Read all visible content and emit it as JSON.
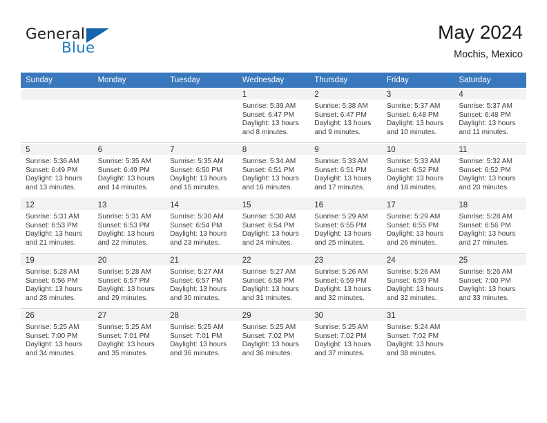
{
  "brand": {
    "name_top": "General",
    "name_bottom": "Blue",
    "flag_color": "#1564ac",
    "text_color": "#231f20",
    "accent_color": "#1f7bc1"
  },
  "header": {
    "month_title": "May 2024",
    "location": "Mochis, Mexico"
  },
  "theme": {
    "header_row_bg": "#3a78bd",
    "header_row_text": "#ffffff",
    "daynum_bg": "#f2f2f2",
    "grid_line": "#d3d3d3"
  },
  "weekdays": [
    "Sunday",
    "Monday",
    "Tuesday",
    "Wednesday",
    "Thursday",
    "Friday",
    "Saturday"
  ],
  "weeks": [
    [
      {
        "day": "",
        "sunrise": "",
        "sunset": "",
        "daylight1": "",
        "daylight2": ""
      },
      {
        "day": "",
        "sunrise": "",
        "sunset": "",
        "daylight1": "",
        "daylight2": ""
      },
      {
        "day": "",
        "sunrise": "",
        "sunset": "",
        "daylight1": "",
        "daylight2": ""
      },
      {
        "day": "1",
        "sunrise": "Sunrise: 5:39 AM",
        "sunset": "Sunset: 6:47 PM",
        "daylight1": "Daylight: 13 hours",
        "daylight2": "and 8 minutes."
      },
      {
        "day": "2",
        "sunrise": "Sunrise: 5:38 AM",
        "sunset": "Sunset: 6:47 PM",
        "daylight1": "Daylight: 13 hours",
        "daylight2": "and 9 minutes."
      },
      {
        "day": "3",
        "sunrise": "Sunrise: 5:37 AM",
        "sunset": "Sunset: 6:48 PM",
        "daylight1": "Daylight: 13 hours",
        "daylight2": "and 10 minutes."
      },
      {
        "day": "4",
        "sunrise": "Sunrise: 5:37 AM",
        "sunset": "Sunset: 6:48 PM",
        "daylight1": "Daylight: 13 hours",
        "daylight2": "and 11 minutes."
      }
    ],
    [
      {
        "day": "5",
        "sunrise": "Sunrise: 5:36 AM",
        "sunset": "Sunset: 6:49 PM",
        "daylight1": "Daylight: 13 hours",
        "daylight2": "and 13 minutes."
      },
      {
        "day": "6",
        "sunrise": "Sunrise: 5:35 AM",
        "sunset": "Sunset: 6:49 PM",
        "daylight1": "Daylight: 13 hours",
        "daylight2": "and 14 minutes."
      },
      {
        "day": "7",
        "sunrise": "Sunrise: 5:35 AM",
        "sunset": "Sunset: 6:50 PM",
        "daylight1": "Daylight: 13 hours",
        "daylight2": "and 15 minutes."
      },
      {
        "day": "8",
        "sunrise": "Sunrise: 5:34 AM",
        "sunset": "Sunset: 6:51 PM",
        "daylight1": "Daylight: 13 hours",
        "daylight2": "and 16 minutes."
      },
      {
        "day": "9",
        "sunrise": "Sunrise: 5:33 AM",
        "sunset": "Sunset: 6:51 PM",
        "daylight1": "Daylight: 13 hours",
        "daylight2": "and 17 minutes."
      },
      {
        "day": "10",
        "sunrise": "Sunrise: 5:33 AM",
        "sunset": "Sunset: 6:52 PM",
        "daylight1": "Daylight: 13 hours",
        "daylight2": "and 18 minutes."
      },
      {
        "day": "11",
        "sunrise": "Sunrise: 5:32 AM",
        "sunset": "Sunset: 6:52 PM",
        "daylight1": "Daylight: 13 hours",
        "daylight2": "and 20 minutes."
      }
    ],
    [
      {
        "day": "12",
        "sunrise": "Sunrise: 5:31 AM",
        "sunset": "Sunset: 6:53 PM",
        "daylight1": "Daylight: 13 hours",
        "daylight2": "and 21 minutes."
      },
      {
        "day": "13",
        "sunrise": "Sunrise: 5:31 AM",
        "sunset": "Sunset: 6:53 PM",
        "daylight1": "Daylight: 13 hours",
        "daylight2": "and 22 minutes."
      },
      {
        "day": "14",
        "sunrise": "Sunrise: 5:30 AM",
        "sunset": "Sunset: 6:54 PM",
        "daylight1": "Daylight: 13 hours",
        "daylight2": "and 23 minutes."
      },
      {
        "day": "15",
        "sunrise": "Sunrise: 5:30 AM",
        "sunset": "Sunset: 6:54 PM",
        "daylight1": "Daylight: 13 hours",
        "daylight2": "and 24 minutes."
      },
      {
        "day": "16",
        "sunrise": "Sunrise: 5:29 AM",
        "sunset": "Sunset: 6:55 PM",
        "daylight1": "Daylight: 13 hours",
        "daylight2": "and 25 minutes."
      },
      {
        "day": "17",
        "sunrise": "Sunrise: 5:29 AM",
        "sunset": "Sunset: 6:55 PM",
        "daylight1": "Daylight: 13 hours",
        "daylight2": "and 26 minutes."
      },
      {
        "day": "18",
        "sunrise": "Sunrise: 5:28 AM",
        "sunset": "Sunset: 6:56 PM",
        "daylight1": "Daylight: 13 hours",
        "daylight2": "and 27 minutes."
      }
    ],
    [
      {
        "day": "19",
        "sunrise": "Sunrise: 5:28 AM",
        "sunset": "Sunset: 6:56 PM",
        "daylight1": "Daylight: 13 hours",
        "daylight2": "and 28 minutes."
      },
      {
        "day": "20",
        "sunrise": "Sunrise: 5:28 AM",
        "sunset": "Sunset: 6:57 PM",
        "daylight1": "Daylight: 13 hours",
        "daylight2": "and 29 minutes."
      },
      {
        "day": "21",
        "sunrise": "Sunrise: 5:27 AM",
        "sunset": "Sunset: 6:57 PM",
        "daylight1": "Daylight: 13 hours",
        "daylight2": "and 30 minutes."
      },
      {
        "day": "22",
        "sunrise": "Sunrise: 5:27 AM",
        "sunset": "Sunset: 6:58 PM",
        "daylight1": "Daylight: 13 hours",
        "daylight2": "and 31 minutes."
      },
      {
        "day": "23",
        "sunrise": "Sunrise: 5:26 AM",
        "sunset": "Sunset: 6:59 PM",
        "daylight1": "Daylight: 13 hours",
        "daylight2": "and 32 minutes."
      },
      {
        "day": "24",
        "sunrise": "Sunrise: 5:26 AM",
        "sunset": "Sunset: 6:59 PM",
        "daylight1": "Daylight: 13 hours",
        "daylight2": "and 32 minutes."
      },
      {
        "day": "25",
        "sunrise": "Sunrise: 5:26 AM",
        "sunset": "Sunset: 7:00 PM",
        "daylight1": "Daylight: 13 hours",
        "daylight2": "and 33 minutes."
      }
    ],
    [
      {
        "day": "26",
        "sunrise": "Sunrise: 5:25 AM",
        "sunset": "Sunset: 7:00 PM",
        "daylight1": "Daylight: 13 hours",
        "daylight2": "and 34 minutes."
      },
      {
        "day": "27",
        "sunrise": "Sunrise: 5:25 AM",
        "sunset": "Sunset: 7:01 PM",
        "daylight1": "Daylight: 13 hours",
        "daylight2": "and 35 minutes."
      },
      {
        "day": "28",
        "sunrise": "Sunrise: 5:25 AM",
        "sunset": "Sunset: 7:01 PM",
        "daylight1": "Daylight: 13 hours",
        "daylight2": "and 36 minutes."
      },
      {
        "day": "29",
        "sunrise": "Sunrise: 5:25 AM",
        "sunset": "Sunset: 7:02 PM",
        "daylight1": "Daylight: 13 hours",
        "daylight2": "and 36 minutes."
      },
      {
        "day": "30",
        "sunrise": "Sunrise: 5:25 AM",
        "sunset": "Sunset: 7:02 PM",
        "daylight1": "Daylight: 13 hours",
        "daylight2": "and 37 minutes."
      },
      {
        "day": "31",
        "sunrise": "Sunrise: 5:24 AM",
        "sunset": "Sunset: 7:02 PM",
        "daylight1": "Daylight: 13 hours",
        "daylight2": "and 38 minutes."
      },
      {
        "day": "",
        "sunrise": "",
        "sunset": "",
        "daylight1": "",
        "daylight2": ""
      }
    ]
  ]
}
